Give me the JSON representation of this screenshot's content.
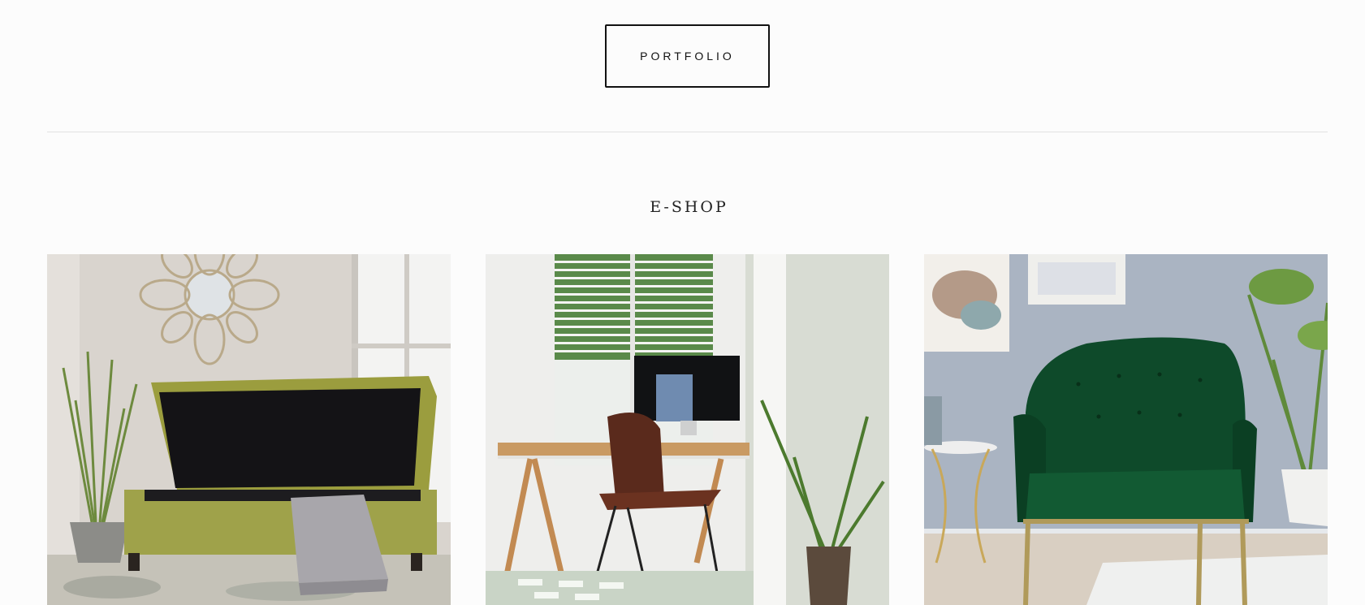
{
  "header": {
    "portfolio_label": "PORTFOLIO"
  },
  "eshop": {
    "title": "E-SHOP",
    "products": [
      {
        "image": "storage-bench-photo"
      },
      {
        "image": "desk-chair-photo"
      },
      {
        "image": "velvet-armchair-photo"
      }
    ]
  }
}
